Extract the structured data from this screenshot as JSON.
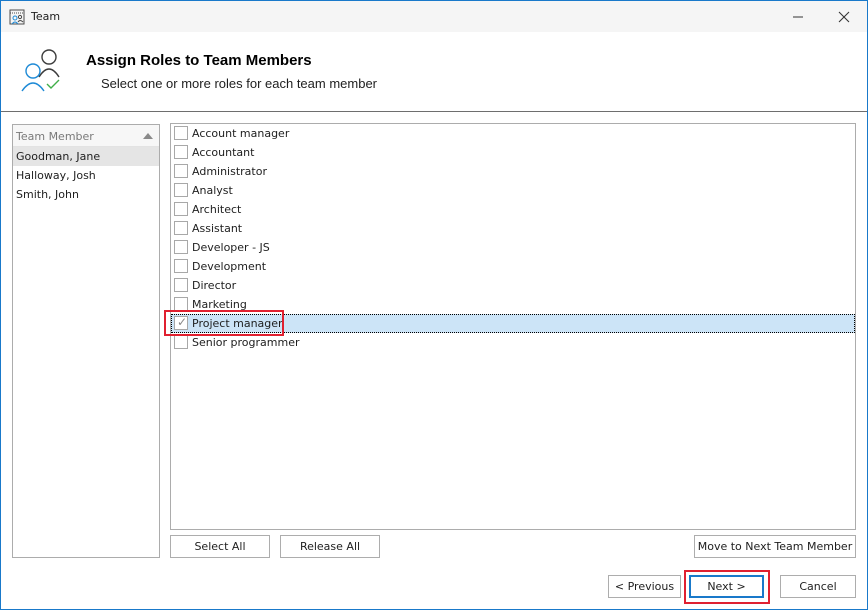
{
  "window": {
    "title": "Team",
    "minimize_label": "Minimize",
    "close_label": "Close"
  },
  "header": {
    "title": "Assign Roles to Team Members",
    "subtitle": "Select one or more roles for each team member"
  },
  "members": {
    "column_header": "Team Member",
    "sort": "ascending",
    "items": [
      {
        "name": "Goodman, Jane",
        "selected": true
      },
      {
        "name": "Halloway, Josh",
        "selected": false
      },
      {
        "name": "Smith, John",
        "selected": false
      }
    ]
  },
  "roles": {
    "items": [
      {
        "label": "Account manager",
        "checked": false
      },
      {
        "label": "Accountant",
        "checked": false
      },
      {
        "label": "Administrator",
        "checked": false
      },
      {
        "label": "Analyst",
        "checked": false
      },
      {
        "label": "Architect",
        "checked": false
      },
      {
        "label": "Assistant",
        "checked": false
      },
      {
        "label": "Developer - JS",
        "checked": false
      },
      {
        "label": "Development",
        "checked": false
      },
      {
        "label": "Director",
        "checked": false
      },
      {
        "label": "Marketing",
        "checked": false
      },
      {
        "label": "Project manager",
        "checked": true,
        "focused": true
      },
      {
        "label": "Senior programmer",
        "checked": false
      }
    ]
  },
  "buttons": {
    "select_all": "Select All",
    "release_all": "Release All",
    "move_next": "Move to Next Team Member",
    "previous": "< Previous",
    "next": "Next >",
    "cancel": "Cancel"
  },
  "colors": {
    "accent": "#1979ca",
    "highlight": "#e02030",
    "selection": "#cce4f7"
  }
}
